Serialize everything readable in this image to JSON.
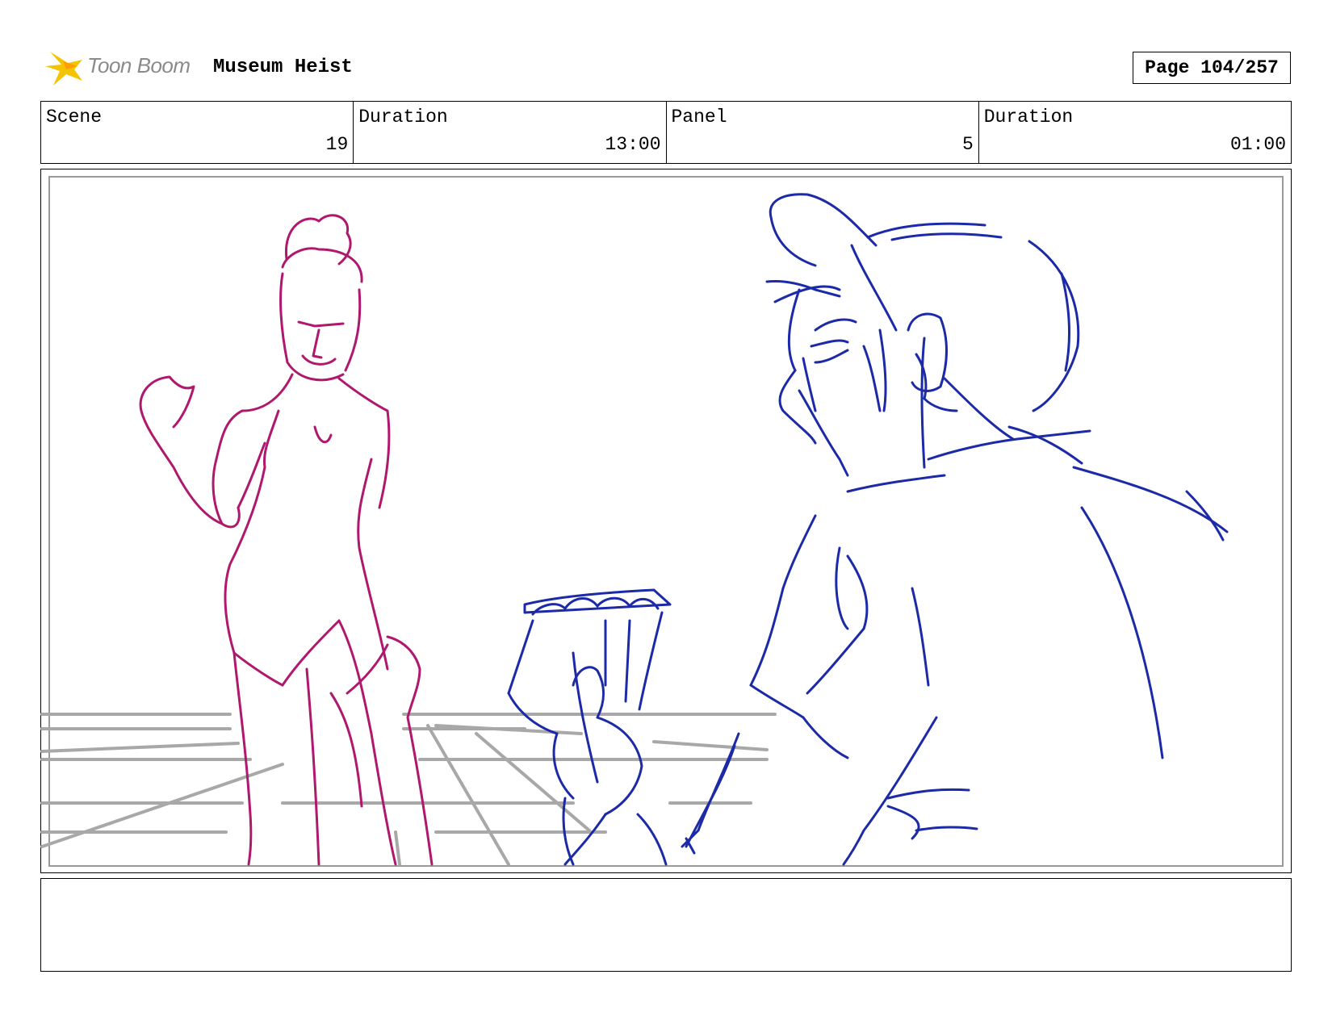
{
  "header": {
    "logo_text": "Toon Boom",
    "project_title": "Museum Heist",
    "page_indicator": "Page 104/257"
  },
  "info": {
    "scene_label": "Scene",
    "scene_value": "19",
    "scene_duration_label": "Duration",
    "scene_duration_value": "13:00",
    "panel_label": "Panel",
    "panel_value": "5",
    "panel_duration_label": "Duration",
    "panel_duration_value": "01:00"
  },
  "colors": {
    "woman_sketch": "#b0186e",
    "man_sketch": "#1c2aa8",
    "floor_lines": "#a8a8a8",
    "logo_accent": "#f5c400"
  },
  "panel": {
    "notes": ""
  }
}
